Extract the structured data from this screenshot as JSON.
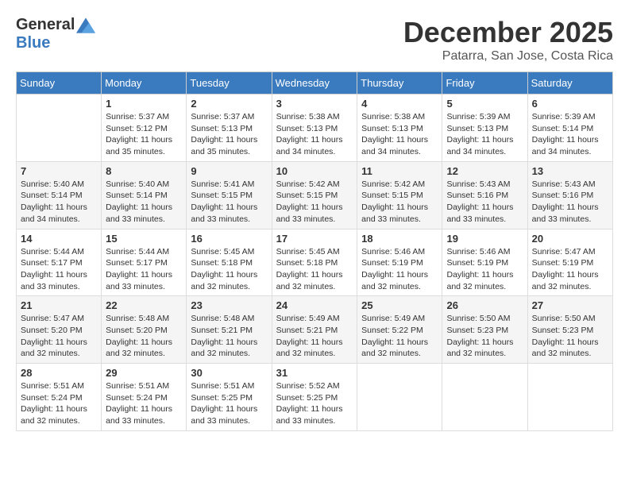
{
  "logo": {
    "general": "General",
    "blue": "Blue"
  },
  "header": {
    "month": "December 2025",
    "location": "Patarra, San Jose, Costa Rica"
  },
  "weekdays": [
    "Sunday",
    "Monday",
    "Tuesday",
    "Wednesday",
    "Thursday",
    "Friday",
    "Saturday"
  ],
  "weeks": [
    [
      {
        "day": "",
        "sunrise": "",
        "sunset": "",
        "daylight": ""
      },
      {
        "day": "1",
        "sunrise": "Sunrise: 5:37 AM",
        "sunset": "Sunset: 5:12 PM",
        "daylight": "Daylight: 11 hours and 35 minutes."
      },
      {
        "day": "2",
        "sunrise": "Sunrise: 5:37 AM",
        "sunset": "Sunset: 5:13 PM",
        "daylight": "Daylight: 11 hours and 35 minutes."
      },
      {
        "day": "3",
        "sunrise": "Sunrise: 5:38 AM",
        "sunset": "Sunset: 5:13 PM",
        "daylight": "Daylight: 11 hours and 34 minutes."
      },
      {
        "day": "4",
        "sunrise": "Sunrise: 5:38 AM",
        "sunset": "Sunset: 5:13 PM",
        "daylight": "Daylight: 11 hours and 34 minutes."
      },
      {
        "day": "5",
        "sunrise": "Sunrise: 5:39 AM",
        "sunset": "Sunset: 5:13 PM",
        "daylight": "Daylight: 11 hours and 34 minutes."
      },
      {
        "day": "6",
        "sunrise": "Sunrise: 5:39 AM",
        "sunset": "Sunset: 5:14 PM",
        "daylight": "Daylight: 11 hours and 34 minutes."
      }
    ],
    [
      {
        "day": "7",
        "sunrise": "Sunrise: 5:40 AM",
        "sunset": "Sunset: 5:14 PM",
        "daylight": "Daylight: 11 hours and 34 minutes."
      },
      {
        "day": "8",
        "sunrise": "Sunrise: 5:40 AM",
        "sunset": "Sunset: 5:14 PM",
        "daylight": "Daylight: 11 hours and 33 minutes."
      },
      {
        "day": "9",
        "sunrise": "Sunrise: 5:41 AM",
        "sunset": "Sunset: 5:15 PM",
        "daylight": "Daylight: 11 hours and 33 minutes."
      },
      {
        "day": "10",
        "sunrise": "Sunrise: 5:42 AM",
        "sunset": "Sunset: 5:15 PM",
        "daylight": "Daylight: 11 hours and 33 minutes."
      },
      {
        "day": "11",
        "sunrise": "Sunrise: 5:42 AM",
        "sunset": "Sunset: 5:15 PM",
        "daylight": "Daylight: 11 hours and 33 minutes."
      },
      {
        "day": "12",
        "sunrise": "Sunrise: 5:43 AM",
        "sunset": "Sunset: 5:16 PM",
        "daylight": "Daylight: 11 hours and 33 minutes."
      },
      {
        "day": "13",
        "sunrise": "Sunrise: 5:43 AM",
        "sunset": "Sunset: 5:16 PM",
        "daylight": "Daylight: 11 hours and 33 minutes."
      }
    ],
    [
      {
        "day": "14",
        "sunrise": "Sunrise: 5:44 AM",
        "sunset": "Sunset: 5:17 PM",
        "daylight": "Daylight: 11 hours and 33 minutes."
      },
      {
        "day": "15",
        "sunrise": "Sunrise: 5:44 AM",
        "sunset": "Sunset: 5:17 PM",
        "daylight": "Daylight: 11 hours and 33 minutes."
      },
      {
        "day": "16",
        "sunrise": "Sunrise: 5:45 AM",
        "sunset": "Sunset: 5:18 PM",
        "daylight": "Daylight: 11 hours and 32 minutes."
      },
      {
        "day": "17",
        "sunrise": "Sunrise: 5:45 AM",
        "sunset": "Sunset: 5:18 PM",
        "daylight": "Daylight: 11 hours and 32 minutes."
      },
      {
        "day": "18",
        "sunrise": "Sunrise: 5:46 AM",
        "sunset": "Sunset: 5:19 PM",
        "daylight": "Daylight: 11 hours and 32 minutes."
      },
      {
        "day": "19",
        "sunrise": "Sunrise: 5:46 AM",
        "sunset": "Sunset: 5:19 PM",
        "daylight": "Daylight: 11 hours and 32 minutes."
      },
      {
        "day": "20",
        "sunrise": "Sunrise: 5:47 AM",
        "sunset": "Sunset: 5:19 PM",
        "daylight": "Daylight: 11 hours and 32 minutes."
      }
    ],
    [
      {
        "day": "21",
        "sunrise": "Sunrise: 5:47 AM",
        "sunset": "Sunset: 5:20 PM",
        "daylight": "Daylight: 11 hours and 32 minutes."
      },
      {
        "day": "22",
        "sunrise": "Sunrise: 5:48 AM",
        "sunset": "Sunset: 5:20 PM",
        "daylight": "Daylight: 11 hours and 32 minutes."
      },
      {
        "day": "23",
        "sunrise": "Sunrise: 5:48 AM",
        "sunset": "Sunset: 5:21 PM",
        "daylight": "Daylight: 11 hours and 32 minutes."
      },
      {
        "day": "24",
        "sunrise": "Sunrise: 5:49 AM",
        "sunset": "Sunset: 5:21 PM",
        "daylight": "Daylight: 11 hours and 32 minutes."
      },
      {
        "day": "25",
        "sunrise": "Sunrise: 5:49 AM",
        "sunset": "Sunset: 5:22 PM",
        "daylight": "Daylight: 11 hours and 32 minutes."
      },
      {
        "day": "26",
        "sunrise": "Sunrise: 5:50 AM",
        "sunset": "Sunset: 5:23 PM",
        "daylight": "Daylight: 11 hours and 32 minutes."
      },
      {
        "day": "27",
        "sunrise": "Sunrise: 5:50 AM",
        "sunset": "Sunset: 5:23 PM",
        "daylight": "Daylight: 11 hours and 32 minutes."
      }
    ],
    [
      {
        "day": "28",
        "sunrise": "Sunrise: 5:51 AM",
        "sunset": "Sunset: 5:24 PM",
        "daylight": "Daylight: 11 hours and 32 minutes."
      },
      {
        "day": "29",
        "sunrise": "Sunrise: 5:51 AM",
        "sunset": "Sunset: 5:24 PM",
        "daylight": "Daylight: 11 hours and 33 minutes."
      },
      {
        "day": "30",
        "sunrise": "Sunrise: 5:51 AM",
        "sunset": "Sunset: 5:25 PM",
        "daylight": "Daylight: 11 hours and 33 minutes."
      },
      {
        "day": "31",
        "sunrise": "Sunrise: 5:52 AM",
        "sunset": "Sunset: 5:25 PM",
        "daylight": "Daylight: 11 hours and 33 minutes."
      },
      {
        "day": "",
        "sunrise": "",
        "sunset": "",
        "daylight": ""
      },
      {
        "day": "",
        "sunrise": "",
        "sunset": "",
        "daylight": ""
      },
      {
        "day": "",
        "sunrise": "",
        "sunset": "",
        "daylight": ""
      }
    ]
  ]
}
